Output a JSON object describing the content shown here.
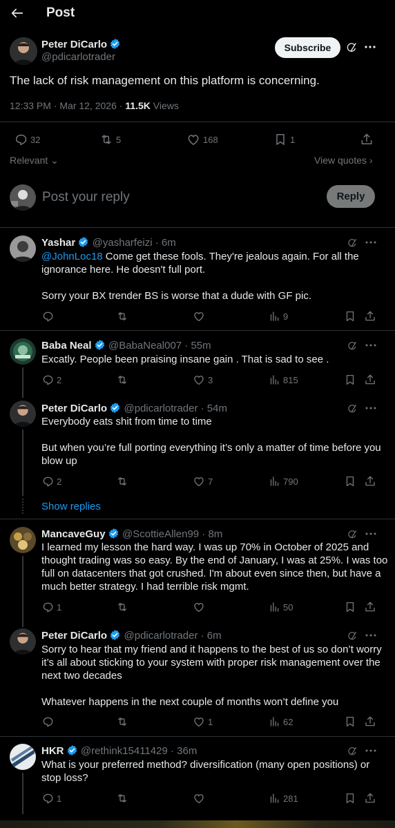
{
  "header": {
    "back_icon": "arrow-left-icon",
    "title": "Post"
  },
  "post": {
    "author_name": "Peter DiCarlo",
    "author_handle": "@pdicarlotrader",
    "subscribe_label": "Subscribe",
    "text": "The lack of risk management on this platform is concerning.",
    "time": "12:33 PM · Mar 12, 2026 · ",
    "views_count": "11.5K",
    "views_label": " Views",
    "stats": {
      "replies": "32",
      "reposts": "5",
      "likes": "168",
      "bookmarks": "1"
    },
    "sort_label": "Relevant",
    "view_quotes_label": "View quotes"
  },
  "composer": {
    "placeholder": "Post your reply",
    "reply_label": "Reply"
  },
  "replies": [
    {
      "name": "Yashar",
      "handle": "@yasharfeizi · 6m",
      "mention": "@JohnLoc18",
      "line1_rest": " Come get these fools. They're jealous again. For all the",
      "line2": "ignorance here. He doesn't full port.",
      "line3": "Sorry your BX trender BS is worse that a dude with GF pic.",
      "replies": "",
      "reposts": "",
      "likes": "",
      "views": "9"
    },
    {
      "name": "Baba Neal",
      "handle": "@BabaNeal007 · 55m",
      "line1": "Excatly. People been praising insane gain . That is sad to see .",
      "replies": "2",
      "reposts": "",
      "likes": "3",
      "views": "815"
    },
    {
      "name": "Peter DiCarlo",
      "handle": "@pdicarlotrader · 54m",
      "line1": "Everybody eats shit from time to time",
      "line2": "But when you’re full porting everything it’s only a matter of time before you",
      "line3": "blow up",
      "replies": "2",
      "reposts": "",
      "likes": "7",
      "views": "790",
      "show_replies": "Show replies"
    },
    {
      "name": "MancaveGuy",
      "handle": "@ScottieAllen99 · 8m",
      "line1": "I learned my lesson the hard way.  I was up 70% in October of 2025 and",
      "line2": "thought trading was so easy.  By the end of January, I was at 25%.  I was too",
      "line3": "full on datacenters that got crushed.  I'm about even since then, but have a",
      "line4": "much better strategy.  I had terrible risk mgmt.",
      "replies": "1",
      "reposts": "",
      "likes": "",
      "views": "50"
    },
    {
      "name": "Peter DiCarlo",
      "handle": "@pdicarlotrader · 6m",
      "line1": "Sorry to hear that my friend and it happens to the best of us so don’t worry",
      "line2": "it’s all about sticking to your system with proper risk management over the",
      "line3": "next two decades",
      "line4": "Whatever happens in the next couple of months won’t define you",
      "replies": "",
      "reposts": "",
      "likes": "1",
      "views": "62"
    },
    {
      "name": "HKR",
      "handle": "@rethink15411429 · 36m",
      "line1": "What is your preferred method? diversification (many open positions) or",
      "line2": "stop loss?",
      "replies": "1",
      "reposts": "",
      "likes": "",
      "views": "281"
    }
  ],
  "colors": {
    "accent": "#1d9bf0",
    "background": "#000000",
    "text": "#e7e9ea",
    "muted": "#71767b",
    "border": "#2f3336"
  }
}
